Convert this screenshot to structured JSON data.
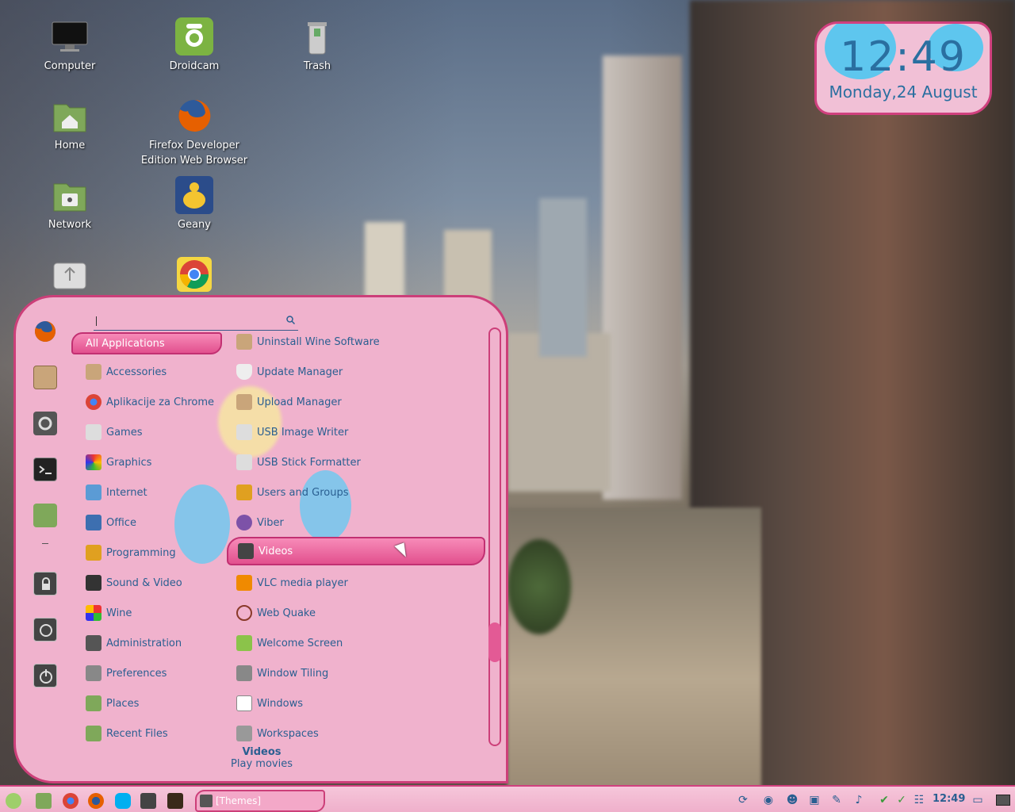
{
  "desktop": {
    "icons": [
      {
        "label": "Computer",
        "icon": "monitor-icon"
      },
      {
        "label": "Droidcam",
        "icon": "android-icon"
      },
      {
        "label": "Trash",
        "icon": "trash-icon"
      },
      {
        "label": "Home",
        "icon": "home-folder-icon"
      },
      {
        "label": "Firefox Developer Edition Web Browser",
        "icon": "firefox-icon"
      },
      {
        "label": "Network",
        "icon": "network-folder-icon"
      },
      {
        "label": "Geany",
        "icon": "geany-icon"
      },
      {
        "label": "",
        "icon": "usb-drive-icon"
      },
      {
        "label": "",
        "icon": "chrome-icon"
      }
    ]
  },
  "clock": {
    "time": "12:49",
    "date": "Monday,24 August"
  },
  "menu": {
    "search": {
      "placeholder": ""
    },
    "favorites": [
      "firefox-icon",
      "package-icon",
      "settings-icon",
      "terminal-icon",
      "folder-icon",
      "separator",
      "lock-icon",
      "logout-icon",
      "power-icon"
    ],
    "categories": [
      {
        "label": "All Applications",
        "selected": true
      },
      {
        "label": "Accessories"
      },
      {
        "label": "Aplikacije za Chrome"
      },
      {
        "label": "Games"
      },
      {
        "label": "Graphics"
      },
      {
        "label": "Internet"
      },
      {
        "label": "Office"
      },
      {
        "label": "Programming"
      },
      {
        "label": "Sound & Video"
      },
      {
        "label": "Wine"
      },
      {
        "label": "Administration"
      },
      {
        "label": "Preferences"
      },
      {
        "label": "Places"
      },
      {
        "label": "Recent Files"
      }
    ],
    "apps": [
      {
        "label": "Uninstall Wine Software"
      },
      {
        "label": "Update Manager"
      },
      {
        "label": "Upload Manager"
      },
      {
        "label": "USB Image Writer"
      },
      {
        "label": "USB Stick Formatter"
      },
      {
        "label": "Users and Groups"
      },
      {
        "label": "Viber"
      },
      {
        "label": "Videos",
        "hovered": true
      },
      {
        "label": "VLC media player"
      },
      {
        "label": "Web Quake"
      },
      {
        "label": "Welcome Screen"
      },
      {
        "label": "Window Tiling"
      },
      {
        "label": "Windows"
      },
      {
        "label": "Workspaces"
      }
    ],
    "description": {
      "title": "Videos",
      "subtitle": "Play movies"
    }
  },
  "panel": {
    "window_button": "[Themes]",
    "time": "12:49",
    "launchers": [
      "mint-menu-icon",
      "files-icon",
      "chrome-icon",
      "firefox-icon",
      "skype-icon",
      "video-icon",
      "system-monitor-icon"
    ],
    "tray": [
      "refresh-icon",
      "camera-icon",
      "user-icon",
      "keyboard-icon",
      "pen-icon",
      "volume-icon",
      "shield-icon",
      "check-icon",
      "network-icon"
    ]
  },
  "colors": {
    "accent": "#cc3f79",
    "menu_bg": "#f0b2cd",
    "text": "#2a5f91"
  }
}
